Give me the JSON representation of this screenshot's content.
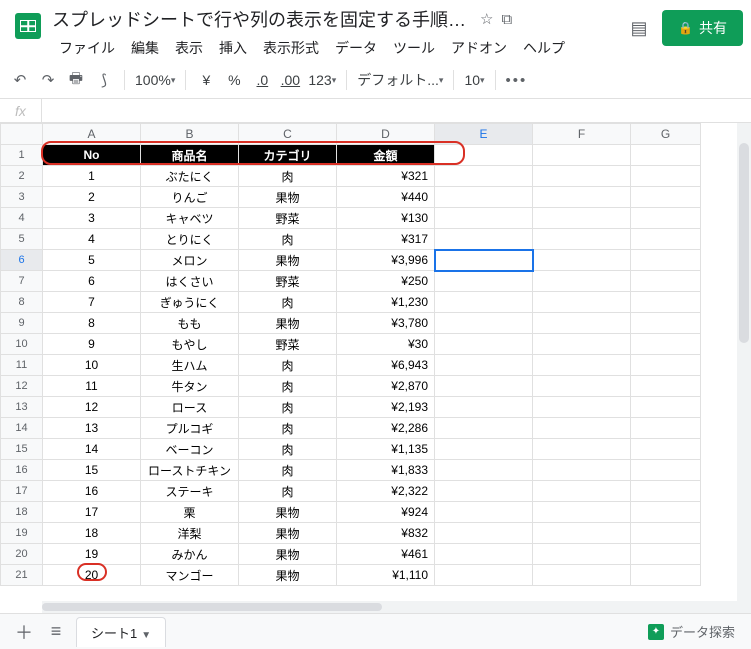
{
  "header": {
    "title": "スプレッドシートで行や列の表示を固定する手順：ウ...",
    "share_label": "共有"
  },
  "menu": [
    "ファイル",
    "編集",
    "表示",
    "挿入",
    "表示形式",
    "データ",
    "ツール",
    "アドオン",
    "ヘルプ"
  ],
  "toolbar": {
    "zoom": "100%",
    "currency": "¥",
    "percent": "%",
    "dec_less": ".0",
    "dec_more": ".00",
    "num_fmt": "123",
    "font": "デフォルト...",
    "font_size": "10"
  },
  "columns": [
    "A",
    "B",
    "C",
    "D",
    "E",
    "F",
    "G"
  ],
  "chart_data": {
    "type": "table",
    "headers": [
      "No",
      "商品名",
      "カテゴリ",
      "金額"
    ],
    "rows": [
      [
        "1",
        "ぶたにく",
        "肉",
        "¥321"
      ],
      [
        "2",
        "りんご",
        "果物",
        "¥440"
      ],
      [
        "3",
        "キャベツ",
        "野菜",
        "¥130"
      ],
      [
        "4",
        "とりにく",
        "肉",
        "¥317"
      ],
      [
        "5",
        "メロン",
        "果物",
        "¥3,996"
      ],
      [
        "6",
        "はくさい",
        "野菜",
        "¥250"
      ],
      [
        "7",
        "ぎゅうにく",
        "肉",
        "¥1,230"
      ],
      [
        "8",
        "もも",
        "果物",
        "¥3,780"
      ],
      [
        "9",
        "もやし",
        "野菜",
        "¥30"
      ],
      [
        "10",
        "生ハム",
        "肉",
        "¥6,943"
      ],
      [
        "11",
        "牛タン",
        "肉",
        "¥2,870"
      ],
      [
        "12",
        "ロース",
        "肉",
        "¥2,193"
      ],
      [
        "13",
        "プルコギ",
        "肉",
        "¥2,286"
      ],
      [
        "14",
        "ベーコン",
        "肉",
        "¥1,135"
      ],
      [
        "15",
        "ローストチキン",
        "肉",
        "¥1,833"
      ],
      [
        "16",
        "ステーキ",
        "肉",
        "¥2,322"
      ],
      [
        "17",
        "栗",
        "果物",
        "¥924"
      ],
      [
        "18",
        "洋梨",
        "果物",
        "¥832"
      ],
      [
        "19",
        "みかん",
        "果物",
        "¥461"
      ],
      [
        "20",
        "マンゴー",
        "果物",
        "¥1,110"
      ]
    ]
  },
  "selected_cell": "E6",
  "sheet_tab": "シート1",
  "explore_label": "データ探索"
}
